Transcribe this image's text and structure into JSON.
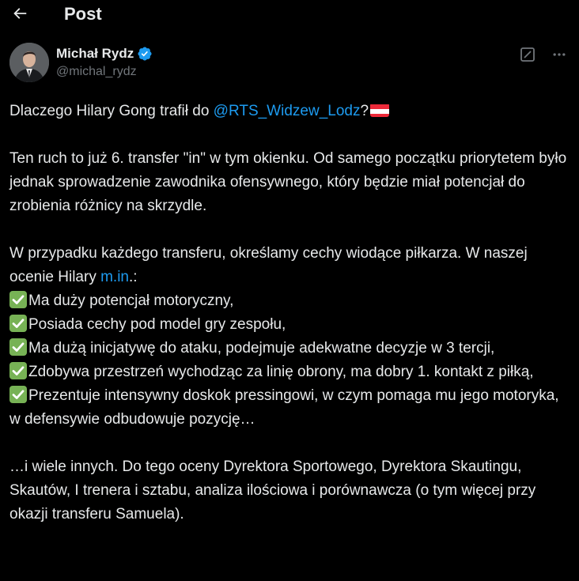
{
  "header": {
    "title": "Post",
    "back_icon": "arrow-left-icon"
  },
  "author": {
    "name": "Michał Rydz",
    "handle": "@michal_rydz",
    "verified": true,
    "verified_color": "#1d9bf0"
  },
  "actions": {
    "grok_icon": "grok-icon",
    "more_icon": "more-horizontal-icon"
  },
  "post": {
    "p1_prefix": "Dlaczego Hilary Gong trafił do ",
    "p1_mention": "@RTS_Widzew_Lodz",
    "p1_suffix": "?",
    "p1_flag": "austria-flag-icon",
    "p2_line": "Ten ruch to już 6. transfer \"in\" w tym okienku. Od samego początku priorytetem było jednak sprowadzenie zawodnika ofensywnego, który będzie miał potencjał do zrobienia różnicy na skrzydle.",
    "p3_prefix": "W przypadku każdego transferu, określamy cechy wiodące piłkarza. W naszej ocenie Hilary ",
    "p3_link": "m.in",
    "p3_suffix": ".:",
    "bullets": [
      "Ma duży potencjał motoryczny,",
      "Posiada cechy pod model gry zespołu,",
      "Ma dużą inicjatywę do ataku, podejmuje adekwatne decyzje w 3 tercji,",
      "Zdobywa przestrzeń wychodząc za linię obrony, ma dobry 1. kontakt z piłką,",
      "Prezentuje intensywny doskok pressingowi, w czym pomaga mu jego motoryka, w defensywie odbudowuje pozycję…"
    ],
    "bullet_icon": "check-mark-button-icon",
    "p4_line": "…i wiele innych. Do tego oceny Dyrektora Sportowego, Dyrektora Skautingu, Skautów, I trenera i sztabu, analiza ilościowa i porównawcza (o tym więcej przy okazji transferu Samuela)."
  },
  "colors": {
    "background": "#000000",
    "text": "#e7e9ea",
    "muted": "#71767b",
    "accent": "#1d9bf0",
    "check_green": "#77b255"
  }
}
